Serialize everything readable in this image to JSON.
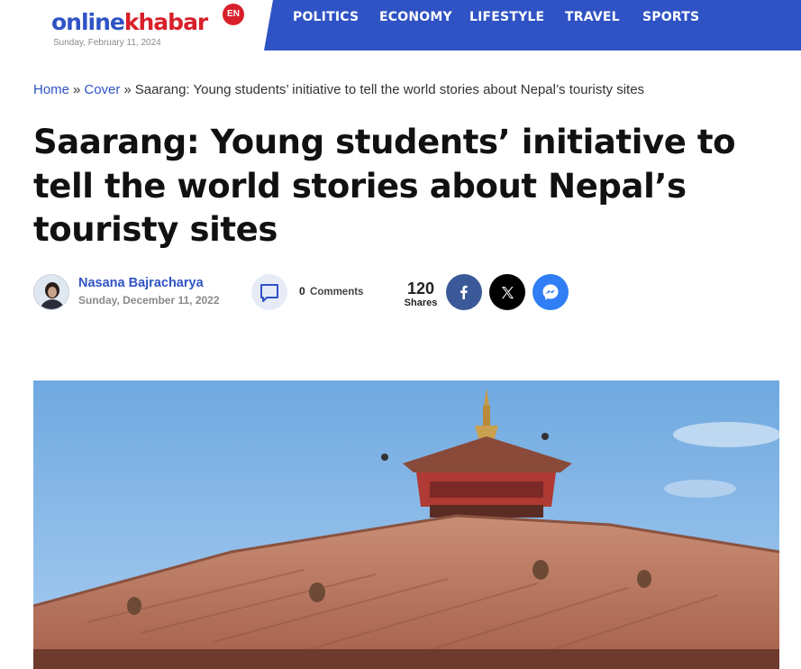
{
  "header": {
    "logo_online": "online",
    "logo_khabar": "khabar",
    "logo_badge": "EN",
    "date": "Sunday, February 11, 2024",
    "brand_blue": "#2f53c4",
    "brand_red": "#d8202a"
  },
  "nav": {
    "items": [
      "POLITICS",
      "ECONOMY",
      "LIFESTYLE",
      "TRAVEL",
      "SPORTS"
    ]
  },
  "breadcrumb": {
    "home": "Home",
    "sep": "»",
    "section": "Cover",
    "current": "Saarang: Young students’ initiative to tell the world stories about Nepal’s touristy sites"
  },
  "article": {
    "title": "Saarang: Young students’ initiative to tell the world stories about Nepal’s touristy sites",
    "author": "Nasana Bajracharya",
    "date": "Sunday, December 11, 2022",
    "comments_count": "0",
    "comments_label": "Comments",
    "shares_count": "120",
    "shares_label": "Shares"
  },
  "share": {
    "facebook_icon": "facebook-f",
    "x_icon": "x-twitter",
    "messenger_icon": "messenger",
    "facebook_color": "#3b5998",
    "x_color": "#000000",
    "messenger_color": "#2f7ef6"
  }
}
